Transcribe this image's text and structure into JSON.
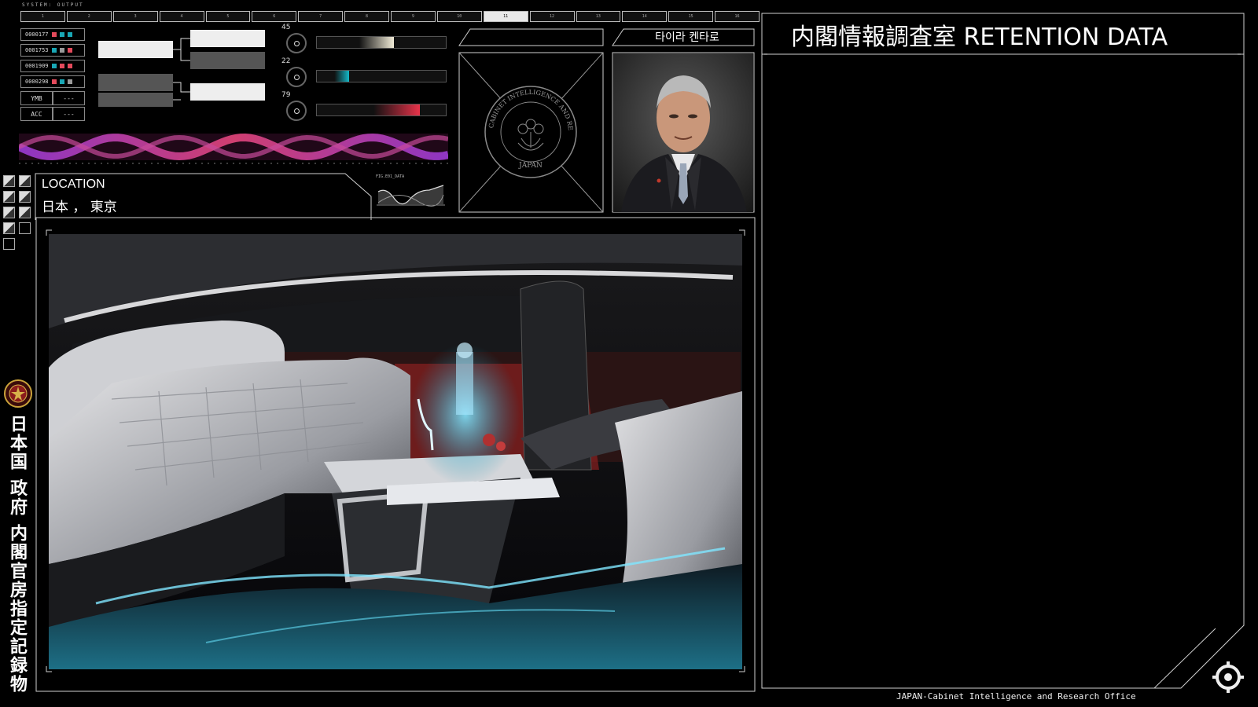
{
  "top_strip": {
    "header": "SYSTEM: OUTPUT",
    "segments": [
      "1",
      "2",
      "3",
      "4",
      "5",
      "6",
      "7",
      "8",
      "9",
      "10",
      "11",
      "12",
      "13",
      "14",
      "15",
      "16"
    ],
    "active_index": 10
  },
  "id_list": [
    {
      "id": "0000177",
      "colors": [
        "#e34a5b",
        "#19a7b5",
        "#19a7b5"
      ]
    },
    {
      "id": "0001753",
      "colors": [
        "#19a7b5",
        "#9a9a9a",
        "#e34a5b"
      ]
    },
    {
      "id": "0001909",
      "colors": [
        "#19a7b5",
        "#e34a5b",
        "#e34a5b"
      ]
    },
    {
      "id": "0000298",
      "colors": [
        "#e34a5b",
        "#19a7b5",
        "#9a9a9a"
      ]
    }
  ],
  "status_fields": [
    {
      "key": "YMB",
      "value": "---"
    },
    {
      "key": "ACC",
      "value": "---"
    }
  ],
  "meters": [
    {
      "label": "45",
      "level": 0.6,
      "color": "#f2ecd8"
    },
    {
      "label": "22",
      "level": 0.25,
      "color": "#14b8c8"
    },
    {
      "label": "79",
      "level": 0.8,
      "color": "#e8334a"
    }
  ],
  "location": {
    "heading": "LOCATION",
    "value": "日本 ， 東京"
  },
  "mini_chart": {
    "label": "FIG.E01_DATA"
  },
  "seal": {
    "text": "CABINET INTELLIGENCE AND RESEARCH OFFICE",
    "country": "JAPAN"
  },
  "profile": {
    "name": "타이라 켄타로"
  },
  "retention": {
    "title": "内閣情報調査室  RETENTION DATA"
  },
  "side": {
    "vertical_text": "日本国 政府 内閣官房指定記録物"
  },
  "footer": {
    "text": "JAPAN-Cabinet Intelligence and Research Office"
  },
  "colors": {
    "accent_cyan": "#19a7b5",
    "accent_red": "#e34a5b",
    "line": "#cfcfcf"
  },
  "icons": {
    "logo": "gear-logo-icon",
    "seal": "government-seal-icon"
  }
}
